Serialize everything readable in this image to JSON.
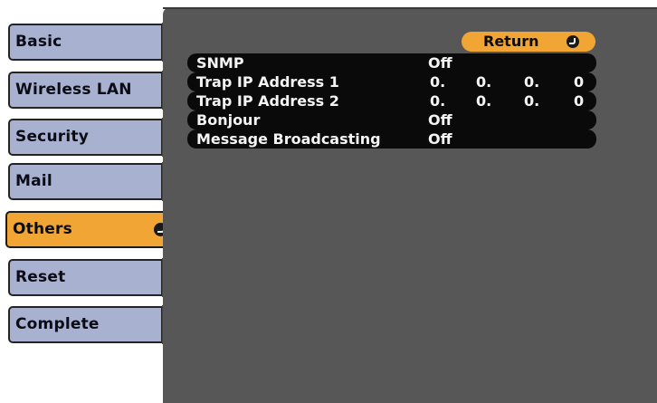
{
  "sidebar": {
    "tabs": [
      {
        "label": "Basic"
      },
      {
        "label": "Wireless LAN"
      },
      {
        "label": "Security"
      },
      {
        "label": "Mail"
      },
      {
        "label": "Others",
        "selected": true
      },
      {
        "label": "Reset"
      },
      {
        "label": "Complete"
      }
    ]
  },
  "main": {
    "return_label": "Return",
    "rows": [
      {
        "label": "SNMP",
        "value": "Off"
      },
      {
        "label": "Trap IP Address 1",
        "ip": [
          "0.",
          "0.",
          "0.",
          "0"
        ]
      },
      {
        "label": "Trap IP Address 2",
        "ip": [
          "0.",
          "0.",
          "0.",
          "0"
        ]
      },
      {
        "label": "Bonjour",
        "value": "Off"
      },
      {
        "label": "Message Broadcasting",
        "value": "Off"
      }
    ]
  },
  "colors": {
    "tab": "#a9b1d1",
    "selected": "#f0a534",
    "panel": "#575757",
    "row": "#0a0a0a"
  }
}
